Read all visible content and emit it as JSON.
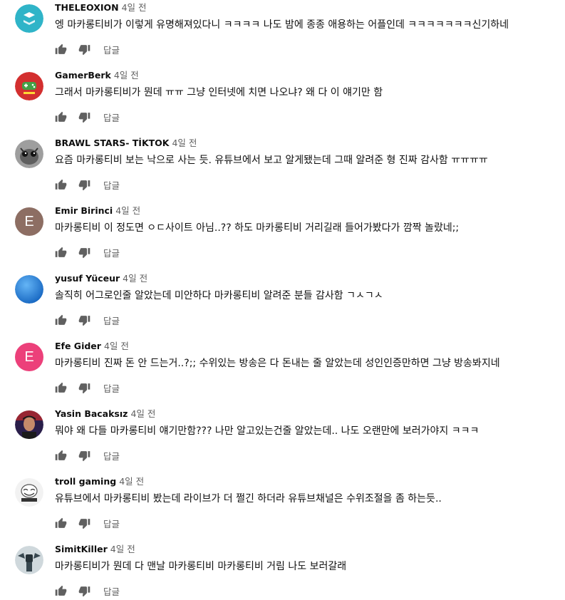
{
  "comments": [
    {
      "author": "THELEOXION",
      "time": "4일 전",
      "text": "엥 마카롱티비가 이렇게 유명해져있다니 ㅋㅋㅋㅋ 나도 밤에 종종 애용하는 어플인데 ㅋㅋㅋㅋㅋㅋㅋ신기하네",
      "avatar_color": "#2fb4c8",
      "avatar_letter": "",
      "avatar_icon": "sk-logo-avatar",
      "reply_label": "답글"
    },
    {
      "author": "GamerBerk",
      "time": "4일 전",
      "text": "그래서 마카롱티비가 뭔데 ㅠㅠ 그냥 인터넷에 치면 나오냐? 왜 다 이 얘기만 함",
      "avatar_color": "#d32f2f",
      "avatar_letter": "",
      "avatar_icon": "gamepad-avatar",
      "reply_label": "답글"
    },
    {
      "author": "BRAWL STARS- TİKTOK",
      "time": "4일 전",
      "text": "요즘 마카롱티비 보는 낙으로 사는 듯. 유튜브에서 보고 알게됐는데 그때 알려준 형 진짜 감사함 ㅠㅠㅠㅠ",
      "avatar_color": "#8a8a8a",
      "avatar_letter": "",
      "avatar_icon": "cat-avatar",
      "reply_label": "답글"
    },
    {
      "author": "Emir Birinci",
      "time": "4일 전",
      "text": "마카롱티비 이 정도면 ㅇㄷ사이트 아님..?? 하도 마카롱티비 거리길래 들어가봤다가 깜짝 놀랐네;;",
      "avatar_color": "#8d6e63",
      "avatar_letter": "E",
      "avatar_icon": "",
      "reply_label": "답글"
    },
    {
      "author": "yusuf Yüceur",
      "time": "4일 전",
      "text": "솔직히 어그로인줄 알았는데 미안하다 마카롱티비 알려준 분들 감사함 ㄱㅅㄱㅅ",
      "avatar_color": "#1e88e5",
      "avatar_letter": "",
      "avatar_icon": "sky-avatar",
      "reply_label": "답글"
    },
    {
      "author": "Efe Gider",
      "time": "4일 전",
      "text": "마카롱티비 진짜 돈 안 드는거..?;; 수위있는 방송은 다 돈내는 줄 알았는데 성인인증만하면 그냥 방송봐지네",
      "avatar_color": "#ec407a",
      "avatar_letter": "E",
      "avatar_icon": "",
      "reply_label": "답글"
    },
    {
      "author": "Yasin Bacaksız",
      "time": "4일 전",
      "text": "뭐야 왜 다들 마카롱티비 얘기만함??? 나만 알고있는건줄 알았는데.. 나도 오랜만에 보러가야지 ㅋㅋㅋ",
      "avatar_color": "#2a1e4a",
      "avatar_letter": "",
      "avatar_icon": "person-avatar",
      "reply_label": "답글"
    },
    {
      "author": "troll gaming",
      "time": "4일 전",
      "text": "유튜브에서 마카롱티비 봤는데 라이브가 더 쩔긴 하더라 유튜브채널은 수위조절을 좀 하는듯..",
      "avatar_color": "#f2f2f2",
      "avatar_letter": "",
      "avatar_icon": "trollface-avatar",
      "reply_label": "답글"
    },
    {
      "author": "SimitKiller",
      "time": "4일 전",
      "text": "마카롱티비가 뭔데 다 맨날 마카롱티비 마카롱티비 거림 나도 보러갈래",
      "avatar_color": "#b0bec5",
      "avatar_letter": "",
      "avatar_icon": "character-avatar",
      "reply_label": "답글"
    }
  ]
}
